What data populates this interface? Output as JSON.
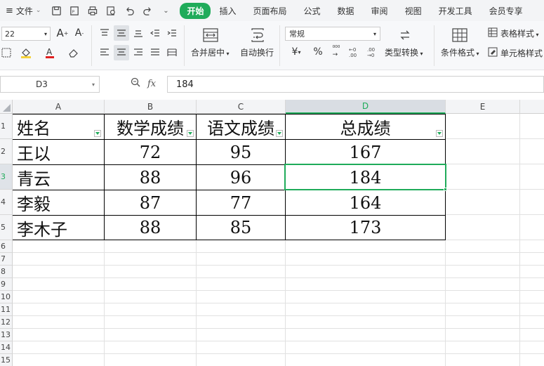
{
  "menu": {
    "file_label": "文件",
    "tabs": [
      "开始",
      "插入",
      "页面布局",
      "公式",
      "数据",
      "审阅",
      "视图",
      "开发工具",
      "会员专享"
    ],
    "active_tab": "开始"
  },
  "ribbon": {
    "font_size": "22",
    "merge_center": "合并居中",
    "wrap_text": "自动换行",
    "number_format": "常规",
    "type_convert": "类型转换",
    "conditional_format": "条件格式",
    "table_style": "表格样式",
    "cell_style": "单元格样式",
    "currency_symbol": "¥",
    "percent_symbol": "%"
  },
  "formula_bar": {
    "name_box": "D3",
    "fx_label": "fx",
    "value": "184"
  },
  "sheet": {
    "columns": [
      "A",
      "B",
      "C",
      "D",
      "E"
    ],
    "selected_column": "D",
    "rows": [
      "1",
      "2",
      "3",
      "4",
      "5",
      "6",
      "7",
      "8",
      "9",
      "10",
      "11",
      "12",
      "13",
      "14",
      "15"
    ],
    "selected_row": "3",
    "headers": [
      "姓名",
      "数学成绩",
      "语文成绩",
      "总成绩"
    ],
    "data": [
      [
        "王以",
        "72",
        "95",
        "167"
      ],
      [
        "青云",
        "88",
        "96",
        "184"
      ],
      [
        "李毅",
        "87",
        "77",
        "164"
      ],
      [
        "李木子",
        "88",
        "85",
        "173"
      ]
    ]
  },
  "colors": {
    "accent": "#1fab5a"
  }
}
